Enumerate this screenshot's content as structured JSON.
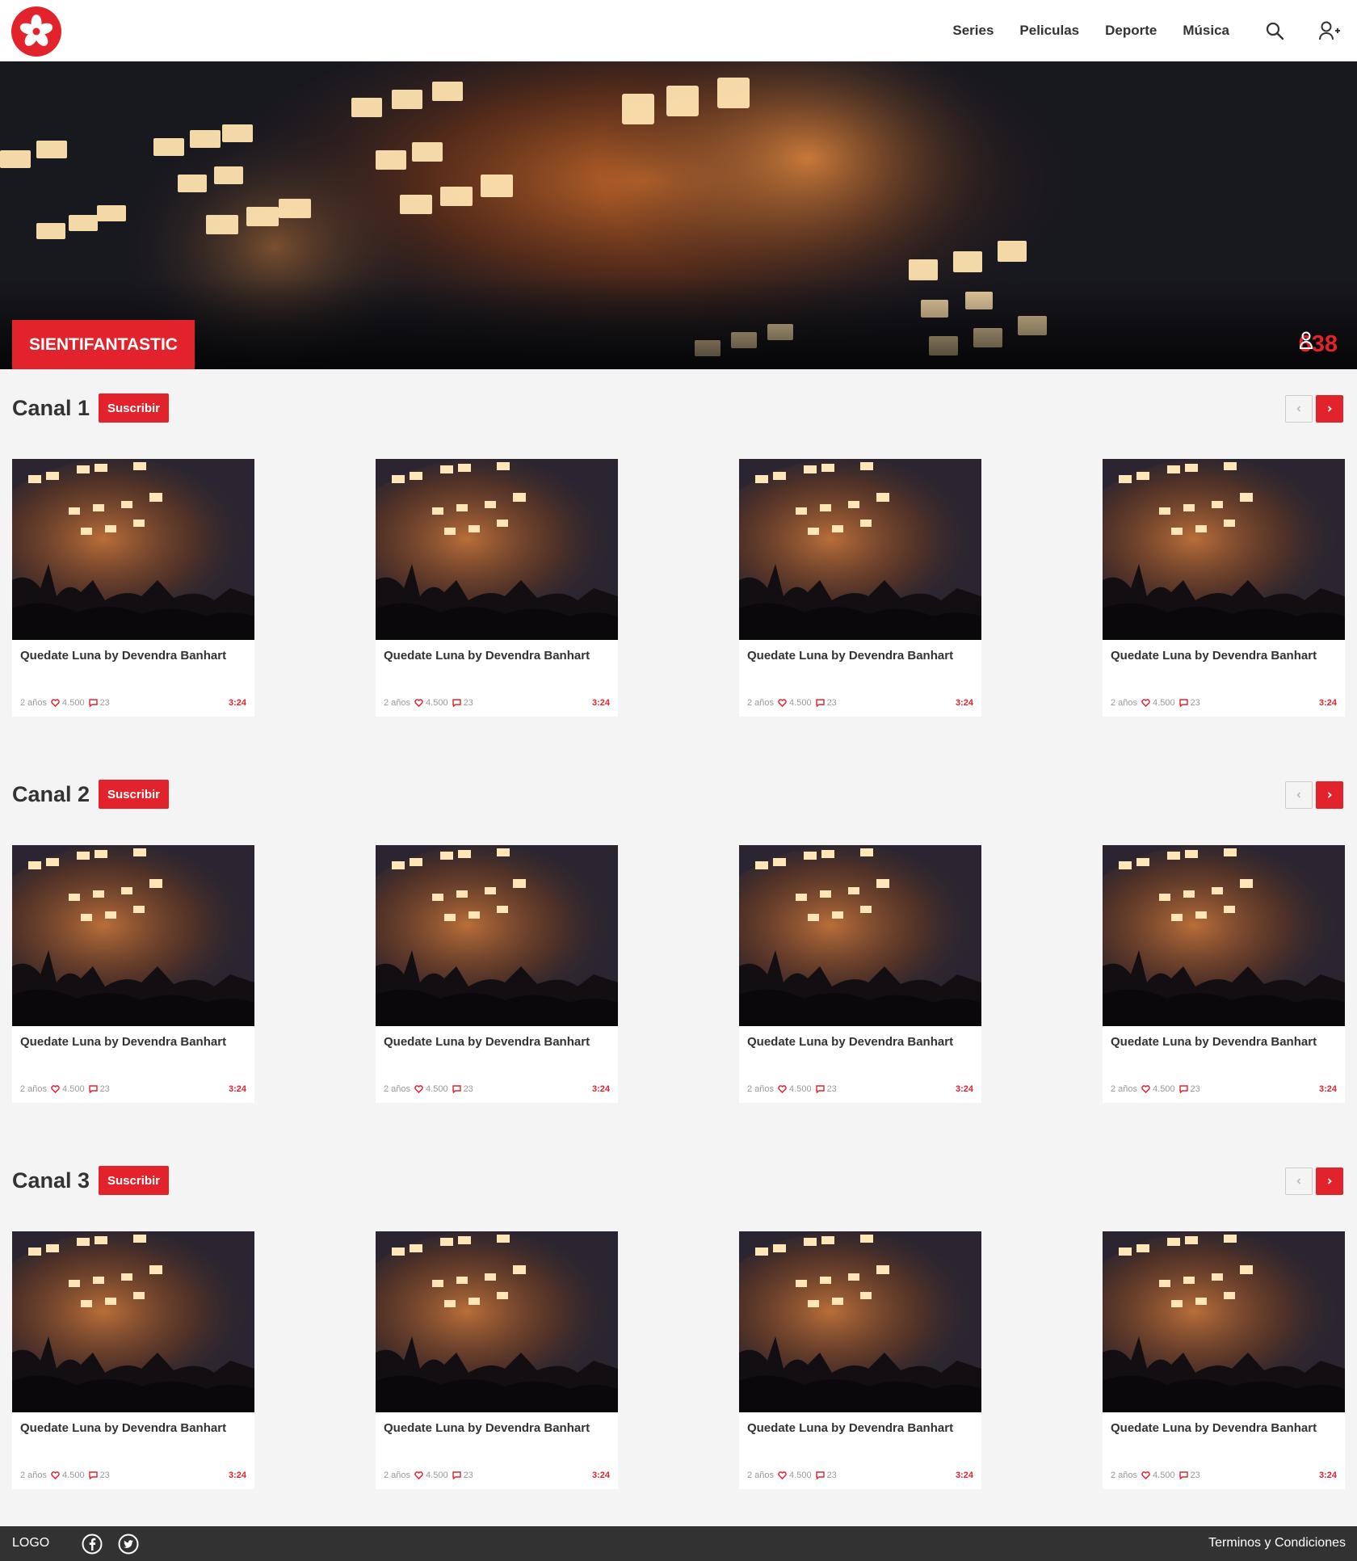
{
  "header": {
    "nav": [
      "Series",
      "Peliculas",
      "Deporte",
      "Música"
    ]
  },
  "hero": {
    "badge": "SIENTIFANTASTIC",
    "count": "638"
  },
  "channels": [
    {
      "title": "Canal 1",
      "subscribe": "Suscribir",
      "cards": [
        {
          "title": "Quedate Luna by Devendra Banhart",
          "age": "2 años",
          "likes": "4.500",
          "comments": "23",
          "duration": "3:24"
        },
        {
          "title": "Quedate Luna by Devendra Banhart",
          "age": "2 años",
          "likes": "4.500",
          "comments": "23",
          "duration": "3:24"
        },
        {
          "title": "Quedate Luna by Devendra Banhart",
          "age": "2 años",
          "likes": "4.500",
          "comments": "23",
          "duration": "3:24"
        },
        {
          "title": "Quedate Luna by Devendra Banhart",
          "age": "2 años",
          "likes": "4.500",
          "comments": "23",
          "duration": "3:24"
        }
      ]
    },
    {
      "title": "Canal 2",
      "subscribe": "Suscribir",
      "cards": [
        {
          "title": "Quedate Luna by Devendra Banhart",
          "age": "2 años",
          "likes": "4.500",
          "comments": "23",
          "duration": "3:24"
        },
        {
          "title": "Quedate Luna by Devendra Banhart",
          "age": "2 años",
          "likes": "4.500",
          "comments": "23",
          "duration": "3:24"
        },
        {
          "title": "Quedate Luna by Devendra Banhart",
          "age": "2 años",
          "likes": "4.500",
          "comments": "23",
          "duration": "3:24"
        },
        {
          "title": "Quedate Luna by Devendra Banhart",
          "age": "2 años",
          "likes": "4.500",
          "comments": "23",
          "duration": "3:24"
        }
      ]
    },
    {
      "title": "Canal 3",
      "subscribe": "Suscribir",
      "cards": [
        {
          "title": "Quedate Luna by Devendra Banhart",
          "age": "2 años",
          "likes": "4.500",
          "comments": "23",
          "duration": "3:24"
        },
        {
          "title": "Quedate Luna by Devendra Banhart",
          "age": "2 años",
          "likes": "4.500",
          "comments": "23",
          "duration": "3:24"
        },
        {
          "title": "Quedate Luna by Devendra Banhart",
          "age": "2 años",
          "likes": "4.500",
          "comments": "23",
          "duration": "3:24"
        },
        {
          "title": "Quedate Luna by Devendra Banhart",
          "age": "2 años",
          "likes": "4.500",
          "comments": "23",
          "duration": "3:24"
        }
      ]
    }
  ],
  "footer": {
    "logo": "LOGO",
    "terms": "Terminos y Condiciones"
  },
  "colors": {
    "accent": "#e3232c",
    "footer_bg": "#323232",
    "page_bg": "#f4f4f4"
  },
  "icons": [
    "flower-logo-icon",
    "search-icon",
    "user-add-icon",
    "person-icon",
    "heart-icon",
    "comment-icon",
    "chevron-left-icon",
    "chevron-right-icon",
    "facebook-icon",
    "twitter-icon"
  ]
}
